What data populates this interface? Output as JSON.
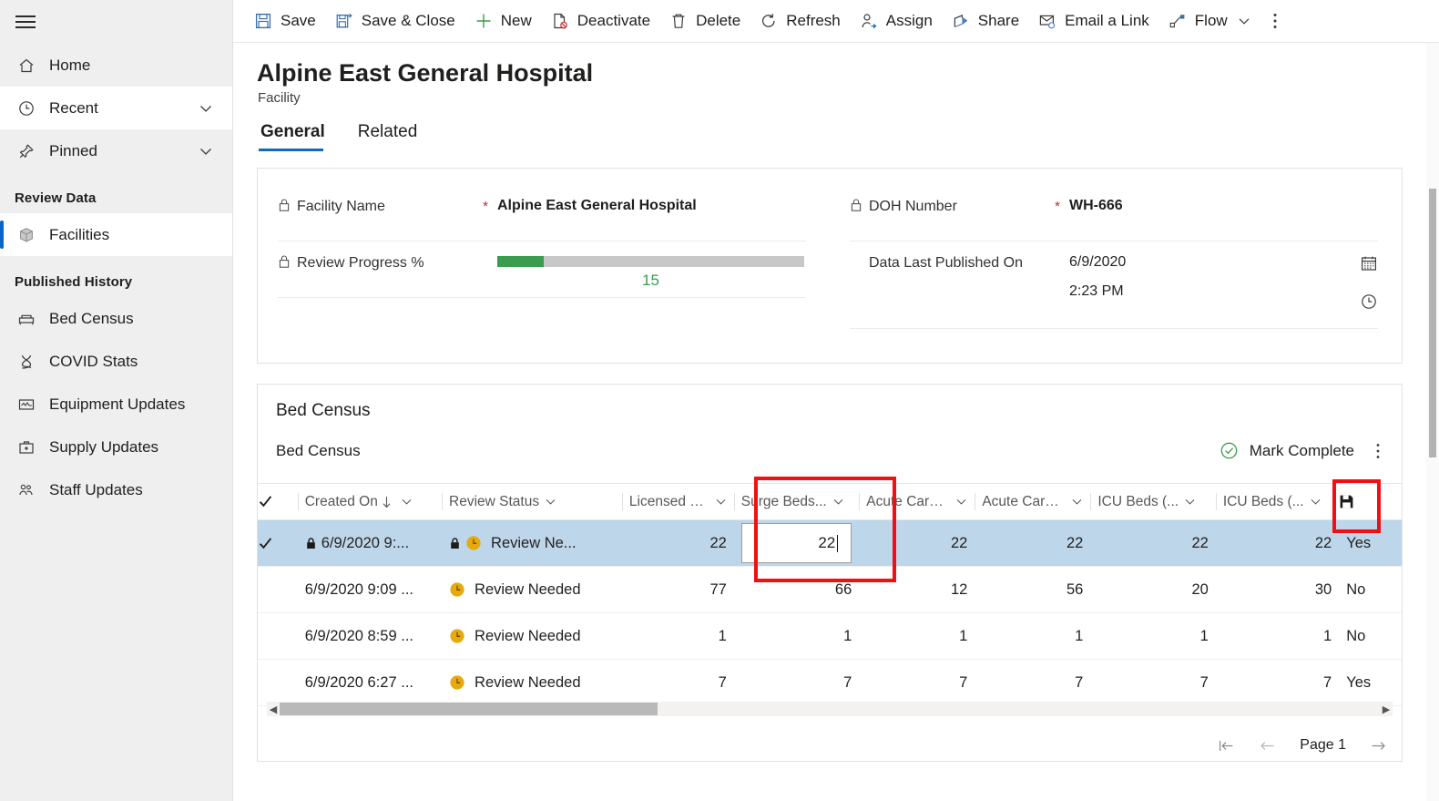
{
  "app": {
    "menu_icon": "hamburger-icon"
  },
  "sidebar": {
    "primary": [
      {
        "label": "Home",
        "icon": "home-icon",
        "expandable": false,
        "selected": false
      },
      {
        "label": "Recent",
        "icon": "clock-icon",
        "expandable": true,
        "selected": false
      },
      {
        "label": "Pinned",
        "icon": "pin-icon",
        "expandable": true,
        "selected": false
      }
    ],
    "groups": [
      {
        "title": "Review Data",
        "items": [
          {
            "label": "Facilities",
            "icon": "cube-icon",
            "selected": true
          }
        ]
      },
      {
        "title": "Published History",
        "items": [
          {
            "label": "Bed Census",
            "icon": "bed-icon",
            "selected": false
          },
          {
            "label": "COVID Stats",
            "icon": "dna-icon",
            "selected": false
          },
          {
            "label": "Equipment Updates",
            "icon": "monitor-icon",
            "selected": false
          },
          {
            "label": "Supply Updates",
            "icon": "medkit-icon",
            "selected": false
          },
          {
            "label": "Staff Updates",
            "icon": "people-icon",
            "selected": false
          }
        ]
      }
    ]
  },
  "commandbar": {
    "items": [
      {
        "label": "Save",
        "icon": "save-icon"
      },
      {
        "label": "Save & Close",
        "icon": "save-close-icon"
      },
      {
        "label": "New",
        "icon": "plus-icon"
      },
      {
        "label": "Deactivate",
        "icon": "deactivate-icon"
      },
      {
        "label": "Delete",
        "icon": "trash-icon"
      },
      {
        "label": "Refresh",
        "icon": "refresh-icon"
      },
      {
        "label": "Assign",
        "icon": "assign-person-icon"
      },
      {
        "label": "Share",
        "icon": "share-icon"
      },
      {
        "label": "Email a Link",
        "icon": "email-link-icon"
      },
      {
        "label": "Flow",
        "icon": "flow-icon",
        "has_chevron": true
      }
    ],
    "overflow_icon": "more-vertical-icon"
  },
  "record": {
    "title": "Alpine East General Hospital",
    "subtitle": "Facility",
    "tabs": [
      {
        "label": "General",
        "selected": true
      },
      {
        "label": "Related",
        "selected": false
      }
    ]
  },
  "form": {
    "left": {
      "facility_name": {
        "label": "Facility Name",
        "required_marker": "*",
        "value": "Alpine East General Hospital",
        "lock_icon": "lock-icon"
      },
      "review_progress": {
        "label": "Review Progress %",
        "value": 15,
        "value_text": "15",
        "bar_color": "#3a9c4c",
        "track_color": "#c8c8c8",
        "lock_icon": "lock-icon"
      }
    },
    "right": {
      "doh_number": {
        "label": "DOH Number",
        "required_marker": "*",
        "value": "WH-666",
        "lock_icon": "lock-icon"
      },
      "data_last_published_on": {
        "label": "Data Last Published On",
        "date": "6/9/2020",
        "time": "2:23 PM",
        "date_icon": "calendar-icon",
        "time_icon": "clock-icon"
      }
    }
  },
  "grid_section": {
    "section_title": "Bed Census",
    "subgrid_title": "Bed Census",
    "mark_complete_label": "Mark Complete",
    "mark_complete_icon": "check-circle-icon",
    "mark_complete_color": "#3a9c4c",
    "overflow_icon": "more-vertical-icon",
    "save_row_icon": "save-floppy-icon"
  },
  "grid": {
    "select_all_icon": "checkmark-icon",
    "columns": [
      {
        "label": "Created On",
        "sorted": true,
        "sort_icon": "arrow-down-icon",
        "has_chevron": true,
        "align": "left"
      },
      {
        "label": "Review Status",
        "has_chevron": true,
        "align": "left"
      },
      {
        "label": "Licensed B...",
        "has_chevron": true,
        "align": "right"
      },
      {
        "label": "Surge Beds...",
        "has_chevron": true,
        "align": "right",
        "highlighted": true
      },
      {
        "label": "Acute Care ...",
        "has_chevron": true,
        "align": "right"
      },
      {
        "label": "Acute Care ...",
        "has_chevron": true,
        "align": "right"
      },
      {
        "label": "ICU Beds (...",
        "has_chevron": true,
        "align": "right"
      },
      {
        "label": "ICU Beds (...",
        "has_chevron": true,
        "align": "right"
      },
      {
        "label": "",
        "has_chevron": false,
        "align": "left"
      }
    ],
    "rows": [
      {
        "selected": true,
        "row_check_icon": "checkmark-icon",
        "created_on": "6/9/2020 9:...",
        "created_on_locked": true,
        "created_on_lock_icon": "lock-icon",
        "status_locked": true,
        "status_lock_icon": "lock-icon",
        "status_icon": "clock-pending-icon",
        "review_status": "Review Ne...",
        "licensed_beds": "22",
        "surge_beds": "22",
        "surge_beds_editing": true,
        "acute_care_1": "22",
        "acute_care_2": "22",
        "icu_beds_1": "22",
        "icu_beds_2": "22",
        "last": "Yes"
      },
      {
        "selected": false,
        "created_on": "6/9/2020 9:09 ...",
        "created_on_locked": false,
        "status_locked": false,
        "status_icon": "clock-pending-icon",
        "review_status": "Review Needed",
        "licensed_beds": "77",
        "surge_beds": "66",
        "acute_care_1": "12",
        "acute_care_2": "56",
        "icu_beds_1": "20",
        "icu_beds_2": "30",
        "last": "No"
      },
      {
        "selected": false,
        "created_on": "6/9/2020 8:59 ...",
        "created_on_locked": false,
        "status_locked": false,
        "status_icon": "clock-pending-icon",
        "review_status": "Review Needed",
        "licensed_beds": "1",
        "surge_beds": "1",
        "acute_care_1": "1",
        "acute_care_2": "1",
        "icu_beds_1": "1",
        "icu_beds_2": "1",
        "last": "No"
      },
      {
        "selected": false,
        "created_on": "6/9/2020 6:27 ...",
        "created_on_locked": false,
        "status_locked": false,
        "status_icon": "clock-pending-icon",
        "review_status": "Review Needed",
        "licensed_beds": "7",
        "surge_beds": "7",
        "acute_care_1": "7",
        "acute_care_2": "7",
        "icu_beds_1": "7",
        "icu_beds_2": "7",
        "last": "Yes"
      }
    ]
  },
  "pager": {
    "first_icon": "page-first-icon",
    "prev_icon": "page-prev-icon",
    "label": "Page 1",
    "next_icon": "page-next-icon"
  },
  "scrollbars": {
    "h_left_arrow": "chevron-left-icon",
    "h_right_arrow": "chevron-right-icon"
  },
  "annotations": {
    "color": "#ee1111",
    "boxes": [
      {
        "name": "surge-beds-edit-highlight"
      },
      {
        "name": "save-row-icon-highlight"
      }
    ]
  }
}
